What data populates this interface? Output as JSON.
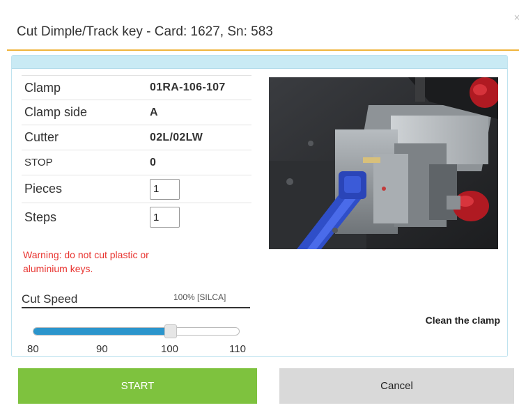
{
  "dialog": {
    "title": "Cut Dimple/Track key - Card: 1627, Sn: 583",
    "close_glyph": "×"
  },
  "params": {
    "clamp_label": "Clamp",
    "clamp_value": "01RA-106-107",
    "clamp_side_label": "Clamp side",
    "clamp_side_value": "A",
    "cutter_label": "Cutter",
    "cutter_value": "02L/02LW",
    "stop_label": "STOP",
    "stop_value": "0",
    "pieces_label": "Pieces",
    "pieces_value": "1",
    "steps_label": "Steps",
    "steps_value": "1"
  },
  "warning": {
    "line1": "Warning: do not cut plastic or",
    "line2": "aluminium keys."
  },
  "speed": {
    "label": "Cut Speed",
    "value_text": "100% [SILCA]",
    "min": 80,
    "max": 110,
    "value": 100,
    "ticks": [
      "80",
      "90",
      "100",
      "110"
    ]
  },
  "image": {
    "description_icon": "machine-clamp-photo"
  },
  "actions": {
    "clean_clamp": "Clean the clamp",
    "start": "START",
    "cancel": "Cancel"
  },
  "colors": {
    "accent_rule": "#f0b43c",
    "start_button": "#7ec23e",
    "cancel_button": "#d9d9d9",
    "slider_fill": "#2b95cc",
    "warning_text": "#e8332f",
    "panel_header": "#c9eaf4"
  }
}
